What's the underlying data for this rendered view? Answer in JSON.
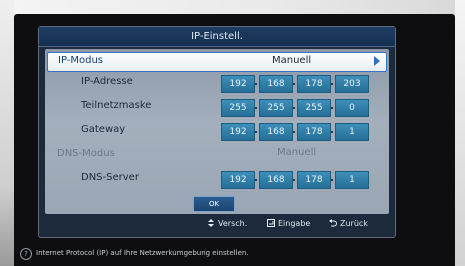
{
  "dialog": {
    "title": "IP-Einstell."
  },
  "fields": {
    "ip_mode": {
      "label": "IP-Modus",
      "value": "Manuell"
    },
    "ip_address": {
      "label": "IP-Adresse",
      "octets": [
        "192",
        "168",
        "178",
        "203"
      ]
    },
    "subnet_mask": {
      "label": "Teilnetzmaske",
      "octets": [
        "255",
        "255",
        "255",
        "0"
      ]
    },
    "gateway": {
      "label": "Gateway",
      "octets": [
        "192",
        "168",
        "178",
        "1"
      ]
    },
    "dns_mode": {
      "label": "DNS-Modus",
      "value": "Manuell"
    },
    "dns_server": {
      "label": "DNS-Server",
      "octets": [
        "192",
        "168",
        "178",
        "1"
      ]
    }
  },
  "ok_button": {
    "label": "OK"
  },
  "footer": {
    "move_label": "Versch.",
    "enter_label": "Eingabe",
    "back_label": "Zurück"
  },
  "status": {
    "text": "Internet Protocol (IP) auf Ihre Netzwerkumgebung einstellen."
  },
  "colors": {
    "accent": "#2f6fc0",
    "ip_box": "#2f7fa9",
    "title_bar": "#1a3a60"
  }
}
